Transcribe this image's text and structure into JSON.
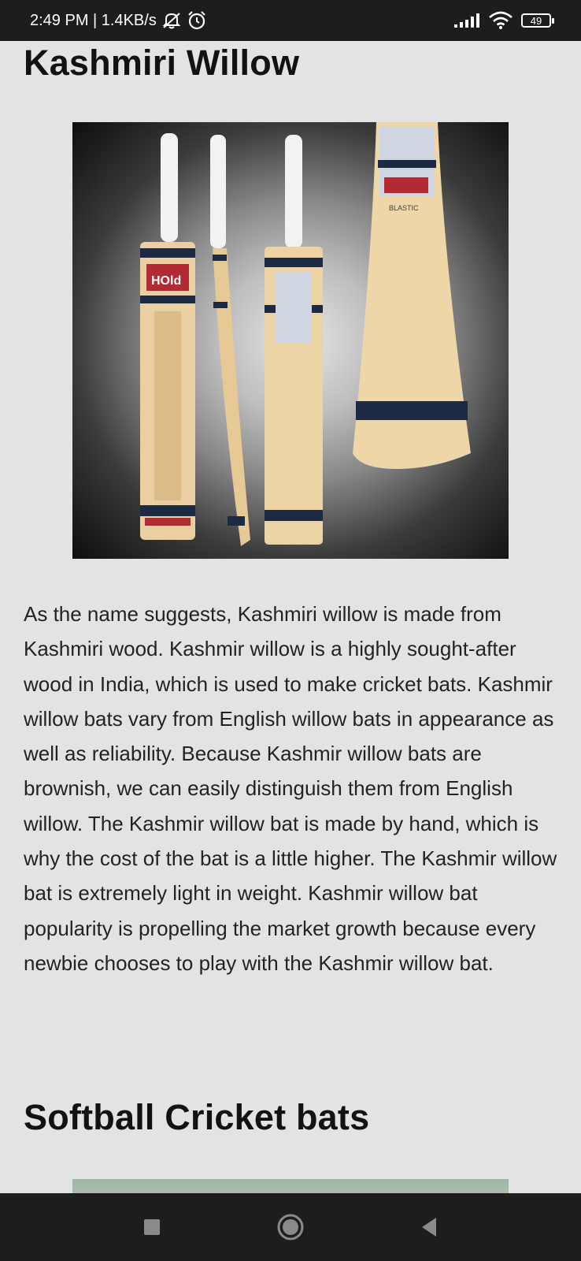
{
  "status_bar": {
    "time": "2:49 PM | 1.4KB/s",
    "battery": "49",
    "icons": [
      "mute-icon",
      "alarm-icon",
      "signal-icon",
      "wifi-icon",
      "battery-icon"
    ]
  },
  "article": {
    "heading_1": "Kashmiri Willow",
    "paragraph_1": "As the name suggests, Kashmiri willow is made from Kashmiri wood. Kashmir willow is a highly sought-after wood in India, which is used to make cricket bats. Kashmir willow bats vary from English willow bats in appearance as well as reliability. Because Kashmir willow bats are brownish, we can easily distinguish them from English willow. The Kashmir willow bat is made by hand, which is why the cost of the bat is a little higher. The Kashmir willow bat is extremely light in weight. Kashmir willow bat popularity is propelling the market growth because every newbie chooses to play with the Kashmir willow bat.",
    "heading_2": "Softball Cricket bats",
    "image_1_brand": "HOld",
    "image_1_sub": "BLASTIC"
  },
  "nav_bar": {
    "icons": [
      "recents-icon",
      "home-icon",
      "back-icon"
    ]
  }
}
